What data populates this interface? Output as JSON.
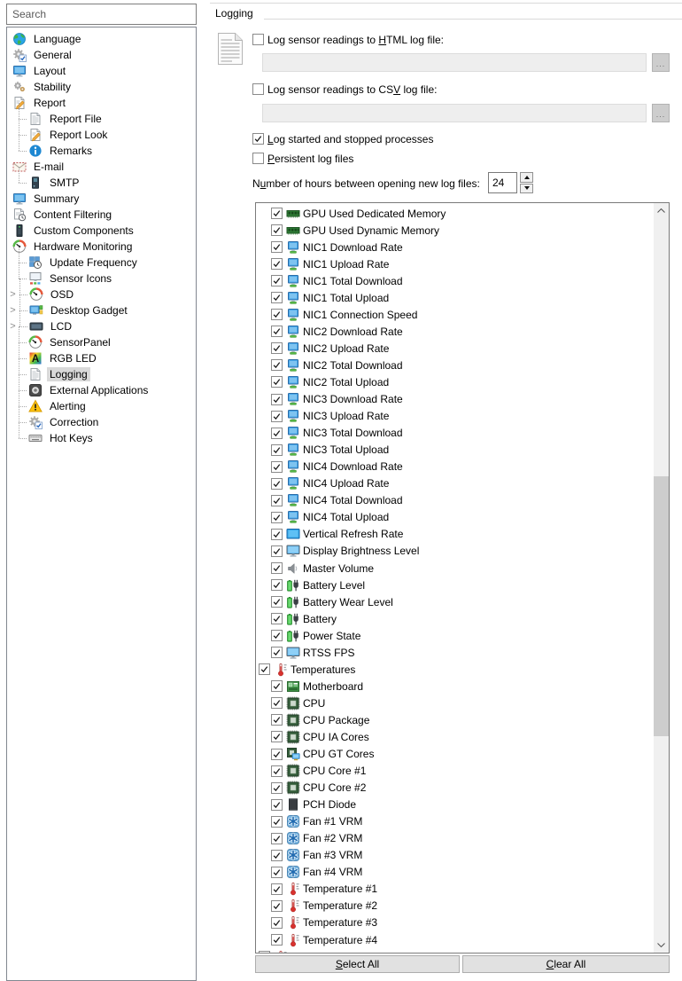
{
  "sidebar": {
    "search_placeholder": "Search",
    "items": [
      {
        "label": "Language",
        "icon": "globe",
        "level": 0
      },
      {
        "label": "General",
        "icon": "gear-check",
        "level": 0
      },
      {
        "label": "Layout",
        "icon": "monitor",
        "level": 0
      },
      {
        "label": "Stability",
        "icon": "gears",
        "level": 0
      },
      {
        "label": "Report",
        "icon": "doc-pencil",
        "level": 0
      },
      {
        "label": "Report File",
        "icon": "doc",
        "level": 1
      },
      {
        "label": "Report Look",
        "icon": "doc-pencil",
        "level": 1
      },
      {
        "label": "Remarks",
        "icon": "info",
        "level": 1
      },
      {
        "label": "E-mail",
        "icon": "envelope",
        "level": 0
      },
      {
        "label": "SMTP",
        "icon": "server",
        "level": 1
      },
      {
        "label": "Summary",
        "icon": "monitor",
        "level": 0
      },
      {
        "label": "Content Filtering",
        "icon": "doc-clock",
        "level": 0
      },
      {
        "label": "Custom Components",
        "icon": "tower",
        "level": 0
      },
      {
        "label": "Hardware Monitoring",
        "icon": "gauge",
        "level": 0
      },
      {
        "label": "Update Frequency",
        "icon": "grid-clock",
        "level": 1
      },
      {
        "label": "Sensor Icons",
        "icon": "monitor-icons",
        "level": 1
      },
      {
        "label": "OSD",
        "icon": "gauge",
        "level": 1,
        "expandable": true
      },
      {
        "label": "Desktop Gadget",
        "icon": "gadget",
        "level": 1,
        "expandable": true
      },
      {
        "label": "LCD",
        "icon": "lcd",
        "level": 1,
        "expandable": true
      },
      {
        "label": "SensorPanel",
        "icon": "gauge",
        "level": 1
      },
      {
        "label": "RGB LED",
        "icon": "rgb",
        "level": 1
      },
      {
        "label": "Logging",
        "icon": "doc",
        "level": 1,
        "selected": true
      },
      {
        "label": "External Applications",
        "icon": "external-app",
        "level": 1
      },
      {
        "label": "Alerting",
        "icon": "warning",
        "level": 1
      },
      {
        "label": "Correction",
        "icon": "gear-check",
        "level": 1
      },
      {
        "label": "Hot Keys",
        "icon": "keyboard",
        "level": 1
      }
    ]
  },
  "main": {
    "group_title": "Logging",
    "html_log": {
      "pre": "Log sensor readings to ",
      "key": "H",
      "post": "TML log file:",
      "checked": false,
      "path_value": ""
    },
    "csv_log": {
      "pre": "Log sensor readings to CS",
      "key": "V",
      "post": " log file:",
      "checked": false,
      "path_value": ""
    },
    "browse_label": "...",
    "log_processes": {
      "pre": "",
      "key": "L",
      "post": "og started and stopped processes",
      "checked": true
    },
    "persistent": {
      "pre": "",
      "key": "P",
      "post": "ersistent log files",
      "checked": false
    },
    "hours_label": {
      "pre": "N",
      "key": "u",
      "post": "mber of hours between opening new log files:"
    },
    "hours_value": "24",
    "sensor_list": {
      "items": [
        {
          "label": "GPU Used Dedicated Memory",
          "icon": "mem",
          "level": 1,
          "checked": true
        },
        {
          "label": "GPU Used Dynamic Memory",
          "icon": "mem",
          "level": 1,
          "checked": true
        },
        {
          "label": "NIC1 Download Rate",
          "icon": "nic",
          "level": 1,
          "checked": true
        },
        {
          "label": "NIC1 Upload Rate",
          "icon": "nic",
          "level": 1,
          "checked": true
        },
        {
          "label": "NIC1 Total Download",
          "icon": "nic",
          "level": 1,
          "checked": true
        },
        {
          "label": "NIC1 Total Upload",
          "icon": "nic",
          "level": 1,
          "checked": true
        },
        {
          "label": "NIC1 Connection Speed",
          "icon": "nic",
          "level": 1,
          "checked": true
        },
        {
          "label": "NIC2 Download Rate",
          "icon": "nic",
          "level": 1,
          "checked": true
        },
        {
          "label": "NIC2 Upload Rate",
          "icon": "nic",
          "level": 1,
          "checked": true
        },
        {
          "label": "NIC2 Total Download",
          "icon": "nic",
          "level": 1,
          "checked": true
        },
        {
          "label": "NIC2 Total Upload",
          "icon": "nic",
          "level": 1,
          "checked": true
        },
        {
          "label": "NIC3 Download Rate",
          "icon": "nic",
          "level": 1,
          "checked": true
        },
        {
          "label": "NIC3 Upload Rate",
          "icon": "nic",
          "level": 1,
          "checked": true
        },
        {
          "label": "NIC3 Total Download",
          "icon": "nic",
          "level": 1,
          "checked": true
        },
        {
          "label": "NIC3 Total Upload",
          "icon": "nic",
          "level": 1,
          "checked": true
        },
        {
          "label": "NIC4 Download Rate",
          "icon": "nic",
          "level": 1,
          "checked": true
        },
        {
          "label": "NIC4 Upload Rate",
          "icon": "nic",
          "level": 1,
          "checked": true
        },
        {
          "label": "NIC4 Total Download",
          "icon": "nic",
          "level": 1,
          "checked": true
        },
        {
          "label": "NIC4 Total Upload",
          "icon": "nic",
          "level": 1,
          "checked": true
        },
        {
          "label": "Vertical Refresh Rate",
          "icon": "screen",
          "level": 1,
          "checked": true
        },
        {
          "label": "Display Brightness Level",
          "icon": "monitor2",
          "level": 1,
          "checked": true
        },
        {
          "label": "Master Volume",
          "icon": "speaker",
          "level": 1,
          "checked": true
        },
        {
          "label": "Battery Level",
          "icon": "battery",
          "level": 1,
          "checked": true
        },
        {
          "label": "Battery Wear Level",
          "icon": "battery",
          "level": 1,
          "checked": true
        },
        {
          "label": "Battery",
          "icon": "battery",
          "level": 1,
          "checked": true
        },
        {
          "label": "Power State",
          "icon": "battery",
          "level": 1,
          "checked": true
        },
        {
          "label": "RTSS FPS",
          "icon": "monitor2",
          "level": 1,
          "checked": true
        },
        {
          "label": "Temperatures",
          "icon": "thermo",
          "level": 0,
          "checked": true
        },
        {
          "label": "Motherboard",
          "icon": "mobo",
          "level": 1,
          "checked": true
        },
        {
          "label": "CPU",
          "icon": "cpu",
          "level": 1,
          "checked": true
        },
        {
          "label": "CPU Package",
          "icon": "cpu",
          "level": 1,
          "checked": true
        },
        {
          "label": "CPU IA Cores",
          "icon": "cpu",
          "level": 1,
          "checked": true
        },
        {
          "label": "CPU GT Cores",
          "icon": "cpu-gt",
          "level": 1,
          "checked": true
        },
        {
          "label": "CPU Core #1",
          "icon": "cpu",
          "level": 1,
          "checked": true
        },
        {
          "label": "CPU Core #2",
          "icon": "cpu",
          "level": 1,
          "checked": true
        },
        {
          "label": "PCH Diode",
          "icon": "pch",
          "level": 1,
          "checked": true
        },
        {
          "label": "Fan #1 VRM",
          "icon": "fan",
          "level": 1,
          "checked": true
        },
        {
          "label": "Fan #2 VRM",
          "icon": "fan",
          "level": 1,
          "checked": true
        },
        {
          "label": "Fan #3 VRM",
          "icon": "fan",
          "level": 1,
          "checked": true
        },
        {
          "label": "Fan #4 VRM",
          "icon": "fan",
          "level": 1,
          "checked": true
        },
        {
          "label": "Temperature #1",
          "icon": "thermo",
          "level": 1,
          "checked": true
        },
        {
          "label": "Temperature #2",
          "icon": "thermo",
          "level": 1,
          "checked": true
        },
        {
          "label": "Temperature #3",
          "icon": "thermo",
          "level": 1,
          "checked": true
        },
        {
          "label": "Temperature #4",
          "icon": "thermo",
          "level": 1,
          "checked": true
        },
        {
          "label": "",
          "icon": "thermo",
          "level": 0,
          "checked": false,
          "partial": true
        }
      ]
    },
    "select_all": {
      "pre": "",
      "key": "S",
      "post": "elect All"
    },
    "clear_all": {
      "pre": "",
      "key": "C",
      "post": "lear All"
    }
  },
  "colors": {
    "selection_bg": "#d9d9d9",
    "disabled_field_bg": "#eeeeee",
    "button_bg": "#e1e1e1",
    "scroll_thumb": "#cdcdcd",
    "scroll_track": "#f0f0f0"
  }
}
